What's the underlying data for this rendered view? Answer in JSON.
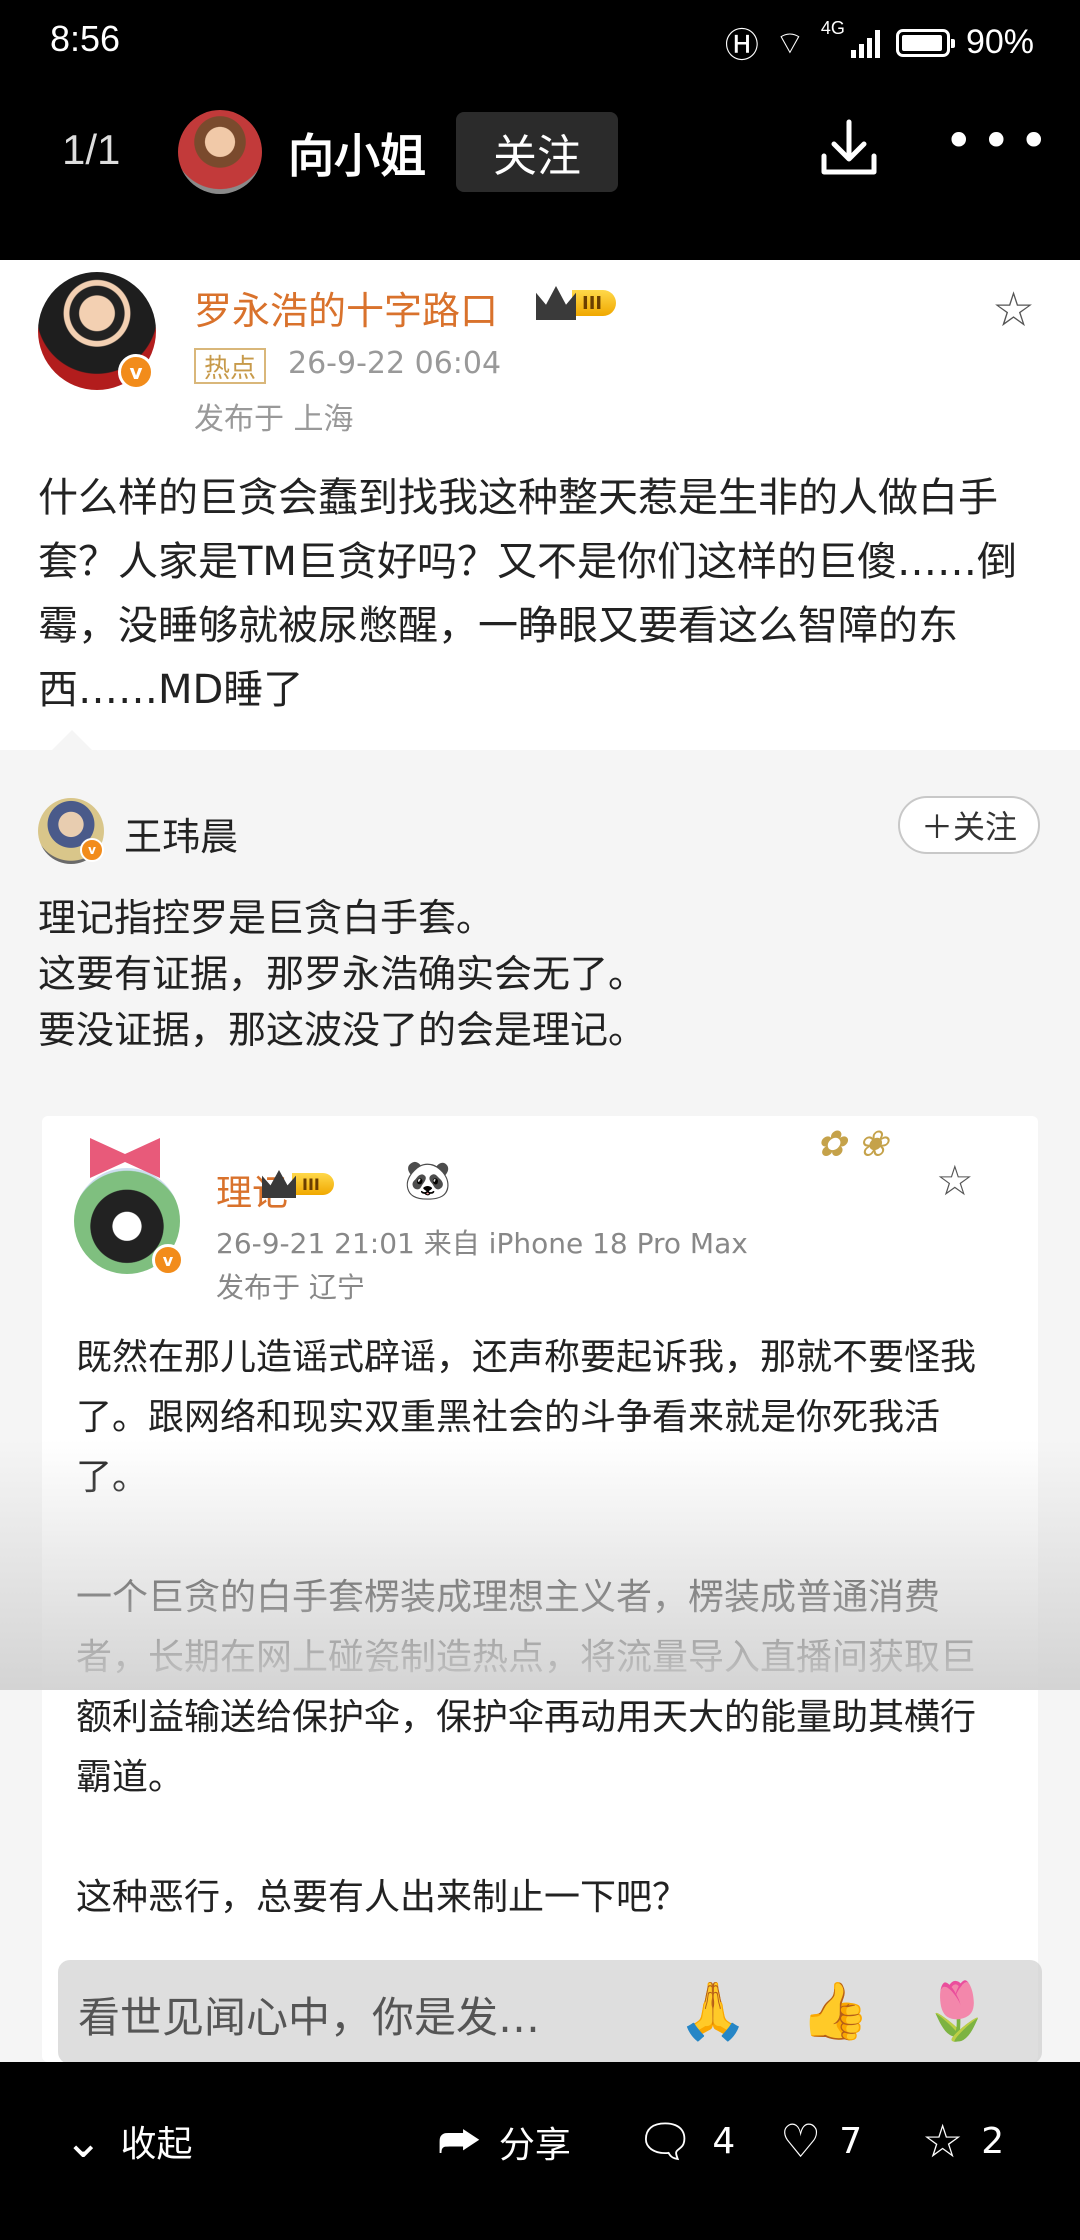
{
  "status_bar": {
    "time": "8:56",
    "network": "4G",
    "battery": "90%"
  },
  "top_nav": {
    "page_indicator": "1/1",
    "author_name": "向小姐",
    "follow_label": "关注"
  },
  "post_main": {
    "author": "罗永浩的十字路口",
    "level": "III",
    "tag": "热点",
    "time": "26-9-22 06:04",
    "location": "发布于 上海",
    "body": "什么样的巨贪会蠢到找我这种整天惹是生非的人做白手套？人家是TM巨贪好吗？又不是你们这样的巨傻……倒霉，没睡够就被尿憋醒，一睁眼又要看这么智障的东西……MD睡了"
  },
  "post_second": {
    "author": "王玮晨",
    "follow_label": "＋关注",
    "lines": [
      "理记指控罗是巨贪白手套。",
      "这要有证据，那罗永浩确实会无了。",
      "要没证据，那这波没了的会是理记。"
    ]
  },
  "quoted_post": {
    "author": "理记",
    "level": "III",
    "panda": "🐼",
    "time": "26-9-21 21:01 来自 iPhone 18 Pro Max",
    "location": "发布于 辽宁",
    "paragraphs": [
      "既然在那儿造谣式辟谣，还声称要起诉我，那就不要怪我了。跟网络和现实双重黑社会的斗争看来就是你死我活了。",
      "一个巨贪的白手套楞装成理想主义者，楞装成普通消费者，长期在网上碰瓷制造热点，将流量导入直播间获取巨额利益输送给保护伞，保护伞再动用天大的能量助其横行霸道。",
      "这种恶行，总要有人出来制止一下吧？"
    ]
  },
  "comment_bar": {
    "placeholder": "看世见闻心中，你是发…",
    "emojis": [
      "🙏",
      "👍",
      "🌷"
    ]
  },
  "bottom_bar": {
    "collapse_label": "收起",
    "share_label": "分享",
    "comment_count": "4",
    "like_count": "7",
    "favorite_count": "2"
  }
}
